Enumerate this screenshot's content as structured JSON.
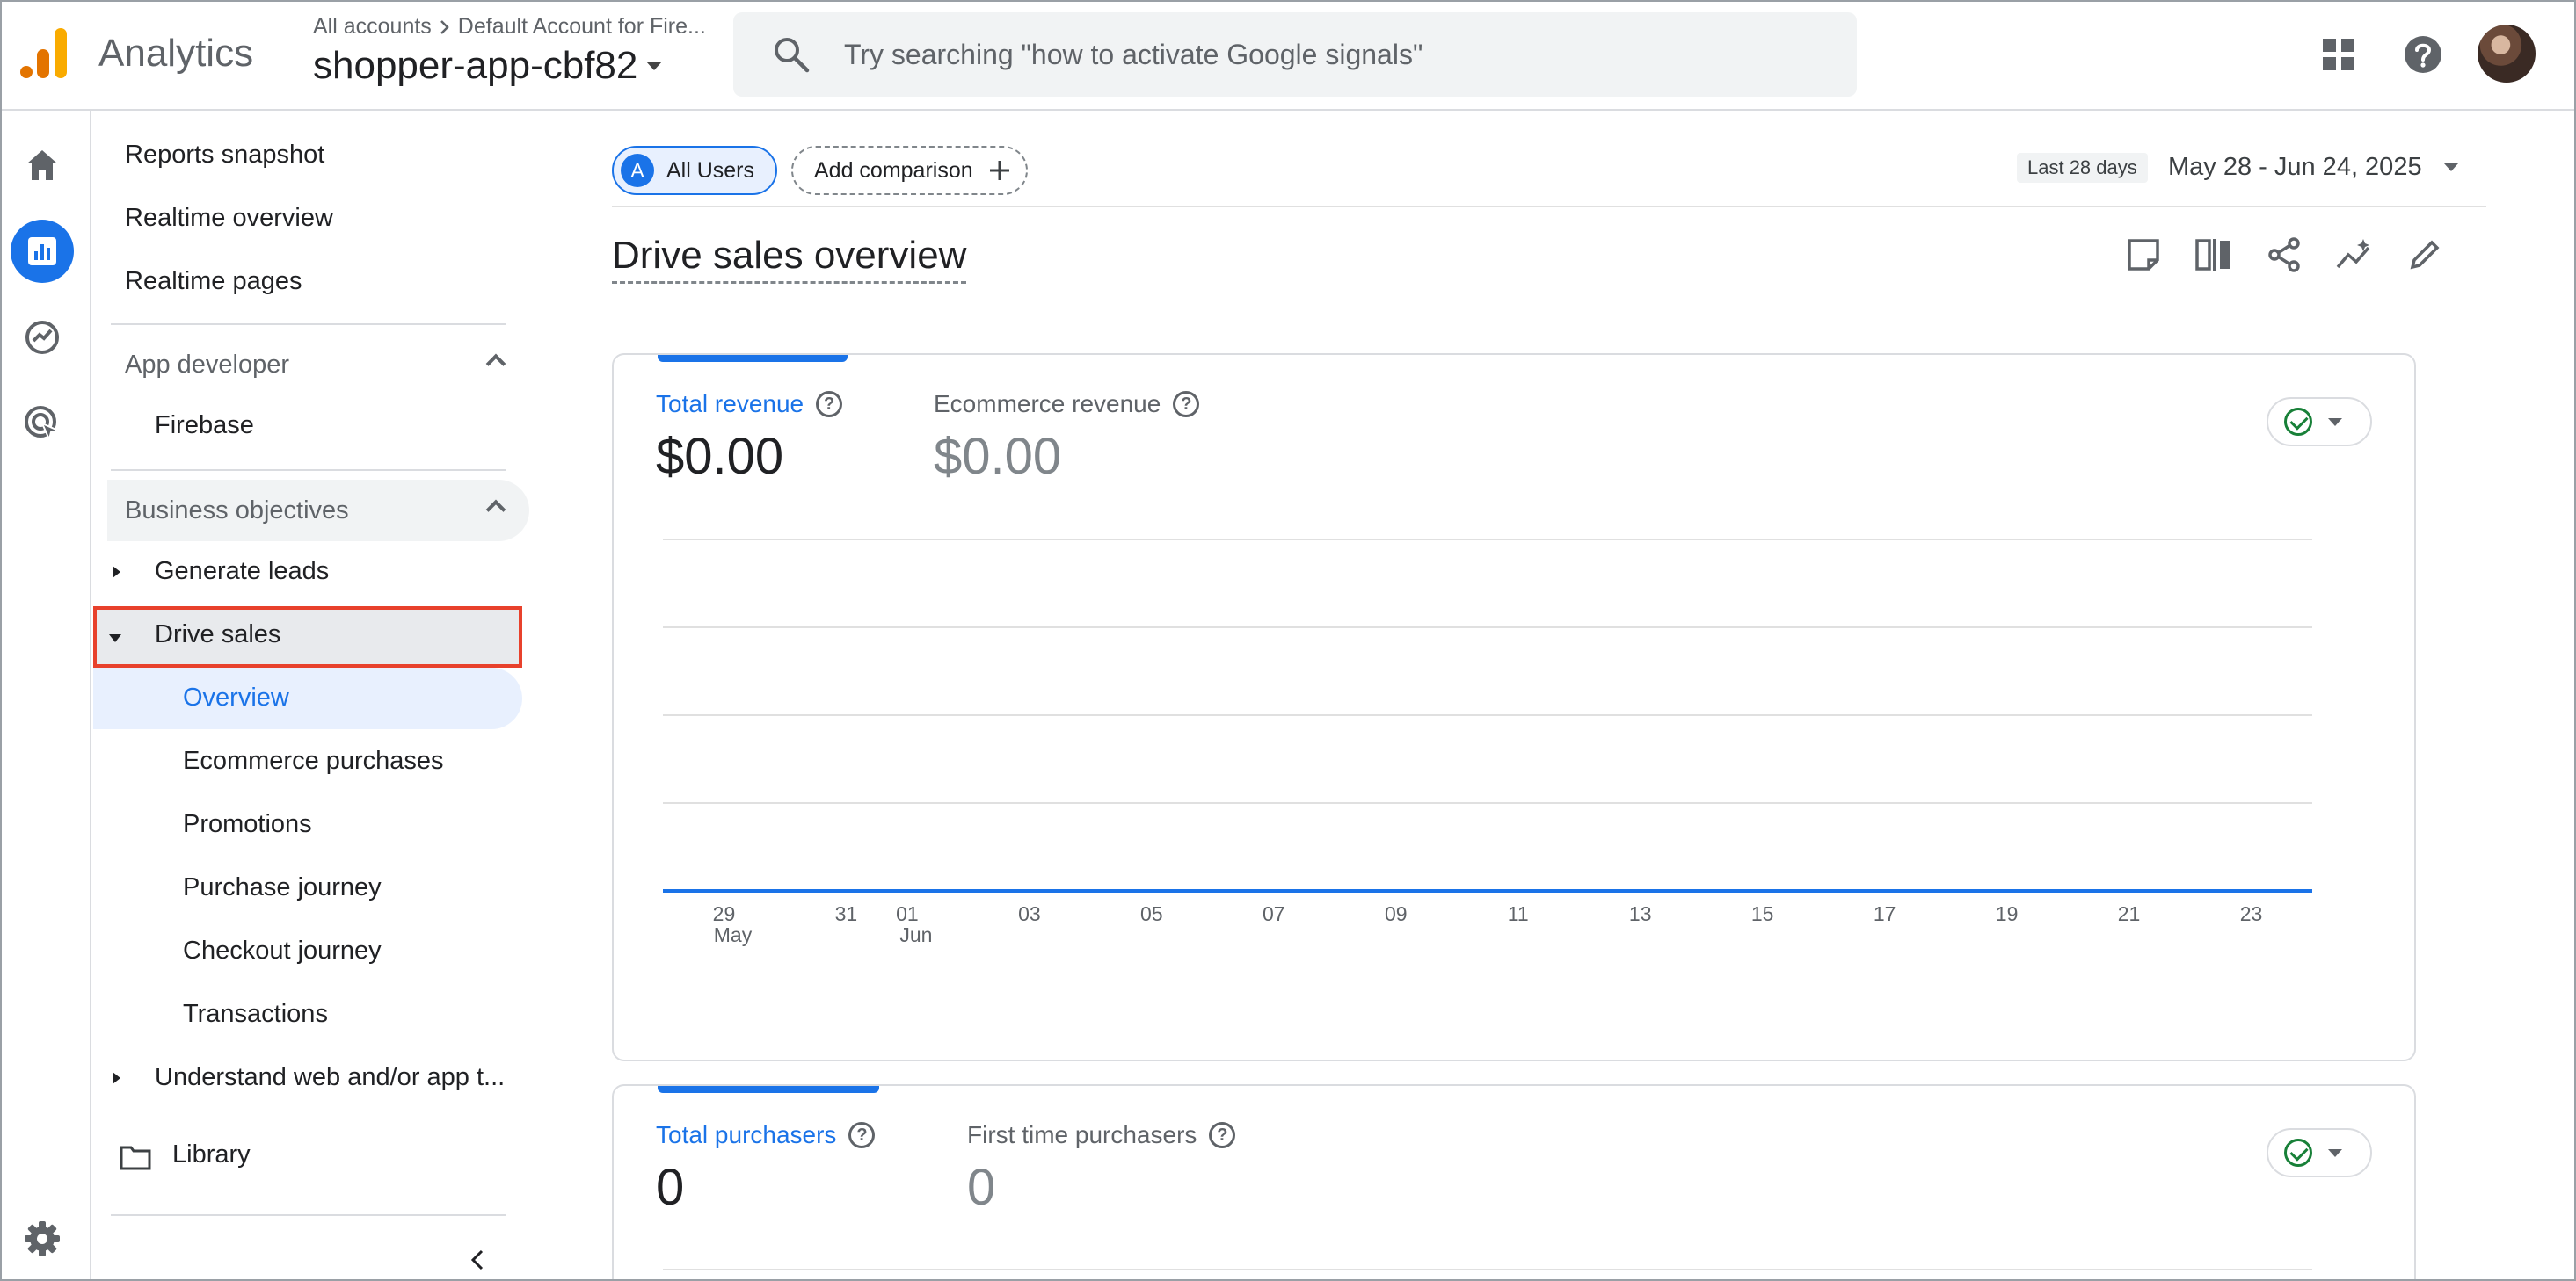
{
  "app": {
    "name": "Analytics"
  },
  "header": {
    "breadcrumb_accounts": "All accounts",
    "breadcrumb_account": "Default Account for Fire...",
    "property": "shopper-app-cbf82",
    "search_placeholder": "Try searching \"how to activate Google signals\""
  },
  "rail": {
    "items": [
      "home-icon",
      "reports-icon",
      "explore-icon",
      "advertising-icon",
      "settings-icon"
    ]
  },
  "nav": {
    "reports_snapshot": "Reports snapshot",
    "realtime_overview": "Realtime overview",
    "realtime_pages": "Realtime pages",
    "app_developer": "App developer",
    "firebase": "Firebase",
    "business_objectives": "Business objectives",
    "generate_leads": "Generate leads",
    "drive_sales": "Drive sales",
    "sub": [
      "Overview",
      "Ecommerce purchases",
      "Promotions",
      "Purchase journey",
      "Checkout journey",
      "Transactions"
    ],
    "understand": "Understand web and/or app t...",
    "library": "Library"
  },
  "toolbar": {
    "segment_badge": "A",
    "segment_label": "All Users",
    "add_comparison": "Add comparison",
    "date_label": "Last 28 days",
    "date_range": "May 28 - Jun 24, 2025"
  },
  "page": {
    "title": "Drive sales overview"
  },
  "card1": {
    "metric_primary_label": "Total revenue",
    "metric_primary_value": "$0.00",
    "metric_secondary_label": "Ecommerce revenue",
    "metric_secondary_value": "$0.00"
  },
  "card2": {
    "metric_primary_label": "Total purchasers",
    "metric_primary_value": "0",
    "metric_secondary_label": "First time purchasers",
    "metric_secondary_value": "0"
  },
  "colors": {
    "accent": "#1a73e8",
    "selected_outline": "#e8412c",
    "status_ok": "#188038"
  },
  "chart_data": {
    "type": "line",
    "x": [
      "May 28",
      "May 29",
      "May 30",
      "May 31",
      "Jun 01",
      "Jun 02",
      "Jun 03",
      "Jun 04",
      "Jun 05",
      "Jun 06",
      "Jun 07",
      "Jun 08",
      "Jun 09",
      "Jun 10",
      "Jun 11",
      "Jun 12",
      "Jun 13",
      "Jun 14",
      "Jun 15",
      "Jun 16",
      "Jun 17",
      "Jun 18",
      "Jun 19",
      "Jun 20",
      "Jun 21",
      "Jun 22",
      "Jun 23",
      "Jun 24"
    ],
    "series": [
      {
        "name": "Total revenue",
        "values": [
          0,
          0,
          0,
          0,
          0,
          0,
          0,
          0,
          0,
          0,
          0,
          0,
          0,
          0,
          0,
          0,
          0,
          0,
          0,
          0,
          0,
          0,
          0,
          0,
          0,
          0,
          0,
          0
        ]
      }
    ],
    "tick_labels": [
      {
        "x": "May 29",
        "day": "29",
        "month": "May"
      },
      {
        "x": "May 31",
        "day": "31",
        "month": ""
      },
      {
        "x": "Jun 01",
        "day": "01",
        "month": "Jun"
      },
      {
        "x": "Jun 03",
        "day": "03",
        "month": ""
      },
      {
        "x": "Jun 05",
        "day": "05",
        "month": ""
      },
      {
        "x": "Jun 07",
        "day": "07",
        "month": ""
      },
      {
        "x": "Jun 09",
        "day": "09",
        "month": ""
      },
      {
        "x": "Jun 11",
        "day": "11",
        "month": ""
      },
      {
        "x": "Jun 13",
        "day": "13",
        "month": ""
      },
      {
        "x": "Jun 15",
        "day": "15",
        "month": ""
      },
      {
        "x": "Jun 17",
        "day": "17",
        "month": ""
      },
      {
        "x": "Jun 19",
        "day": "19",
        "month": ""
      },
      {
        "x": "Jun 21",
        "day": "21",
        "month": ""
      },
      {
        "x": "Jun 23",
        "day": "23",
        "month": ""
      }
    ],
    "grid": true,
    "title": "",
    "xlabel": "",
    "ylabel": ""
  }
}
